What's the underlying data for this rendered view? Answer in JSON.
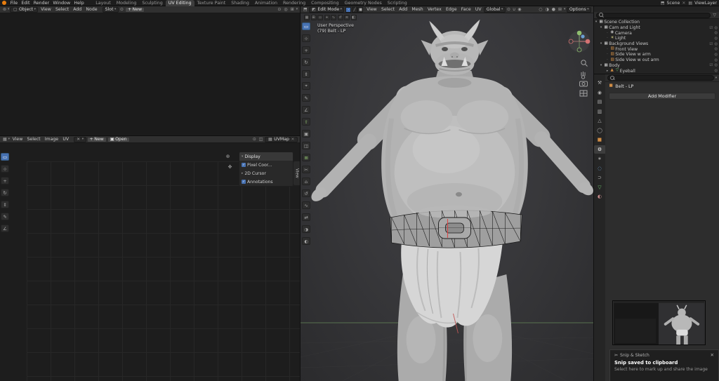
{
  "topbar": {
    "menus": [
      "File",
      "Edit",
      "Render",
      "Window",
      "Help"
    ],
    "workspaces": [
      "Layout",
      "Modeling",
      "Sculpting",
      "UV Editing",
      "Texture Paint",
      "Shading",
      "Animation",
      "Rendering",
      "Compositing",
      "Geometry Nodes",
      "Scripting"
    ],
    "active_workspace": "UV Editing",
    "scene_label": "Scene",
    "viewlayer_label": "ViewLayer"
  },
  "shader_editor": {
    "type_selector": "Object",
    "menus": [
      "View",
      "Select",
      "Add",
      "Node"
    ],
    "slot_label": "Slot",
    "new_button": "New"
  },
  "uv_editor": {
    "menus": [
      "View",
      "Select",
      "Image",
      "UV"
    ],
    "new_button": "New",
    "open_button": "Open",
    "uvmap_selector": "UVMap",
    "npanel": {
      "display_header": "Display",
      "pixel_coords": "Pixel Coor...",
      "cursor_2d": "2D Cursor",
      "annotations": "Annotations",
      "side_tab": "View"
    }
  },
  "viewport_3d": {
    "mode_selector": "Edit Mode",
    "menus": [
      "View",
      "Select",
      "Add",
      "Mesh",
      "Vertex",
      "Edge",
      "Face",
      "UV"
    ],
    "orientation_selector": "Global",
    "options_label": "Options",
    "overlay_line1": "User Perspective",
    "overlay_line2": "(79) Belt - LP"
  },
  "outliner": {
    "rows": [
      {
        "label": "Scene Collection",
        "icon": "collection-icon"
      },
      {
        "label": "Cam and Light",
        "icon": "collection-icon"
      },
      {
        "label": "Camera",
        "icon": "camera-icon"
      },
      {
        "label": "Light",
        "icon": "light-icon"
      },
      {
        "label": "Background Views",
        "icon": "collection-icon"
      },
      {
        "label": "Front View",
        "icon": "image-empty-icon"
      },
      {
        "label": "Side View w arm",
        "icon": "image-empty-icon"
      },
      {
        "label": "Side View w out arm",
        "icon": "image-empty-icon"
      },
      {
        "label": "Body",
        "icon": "collection-icon"
      },
      {
        "label": "Eyeball",
        "icon": "mesh-icon"
      }
    ]
  },
  "properties_panel": {
    "object_name": "Belt - LP",
    "add_modifier_button": "Add Modifier"
  },
  "notification": {
    "app_name": "Snip & Sketch",
    "title": "Snip saved to clipboard",
    "subtitle": "Select here to mark up and share the image"
  },
  "colors": {
    "accent_blue": "#4772b3",
    "object_orange": "#cf8c45",
    "mesh_green": "#6cc06c",
    "seam_red": "#d84848"
  }
}
